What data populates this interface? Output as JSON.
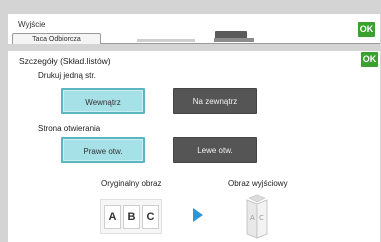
{
  "header": {
    "title": "Wyjście",
    "tab_label": "Taca Odbiorcza",
    "ok_label": "OK"
  },
  "panel": {
    "title": "Szczegóły (Skład.listów)",
    "ok_label": "OK",
    "print_one_page": {
      "label": "Drukuj jedną str.",
      "options": [
        "Wewnątrz",
        "Na zewnątrz"
      ],
      "selected": "Wewnątrz"
    },
    "opening_side": {
      "label": "Strona otwierania",
      "options": [
        "Prawe otw.",
        "Lewe otw."
      ],
      "selected": "Prawe otw."
    },
    "original_image_label": "Oryginalny obraz",
    "output_image_label": "Obraz wyjściowy",
    "original_letters": [
      "A",
      "B",
      "C"
    ],
    "accent_colors": {
      "ok": "#3aa02f",
      "selected": "#a7e1e8",
      "unselected": "#555555",
      "arrow": "#2f95d3"
    }
  }
}
